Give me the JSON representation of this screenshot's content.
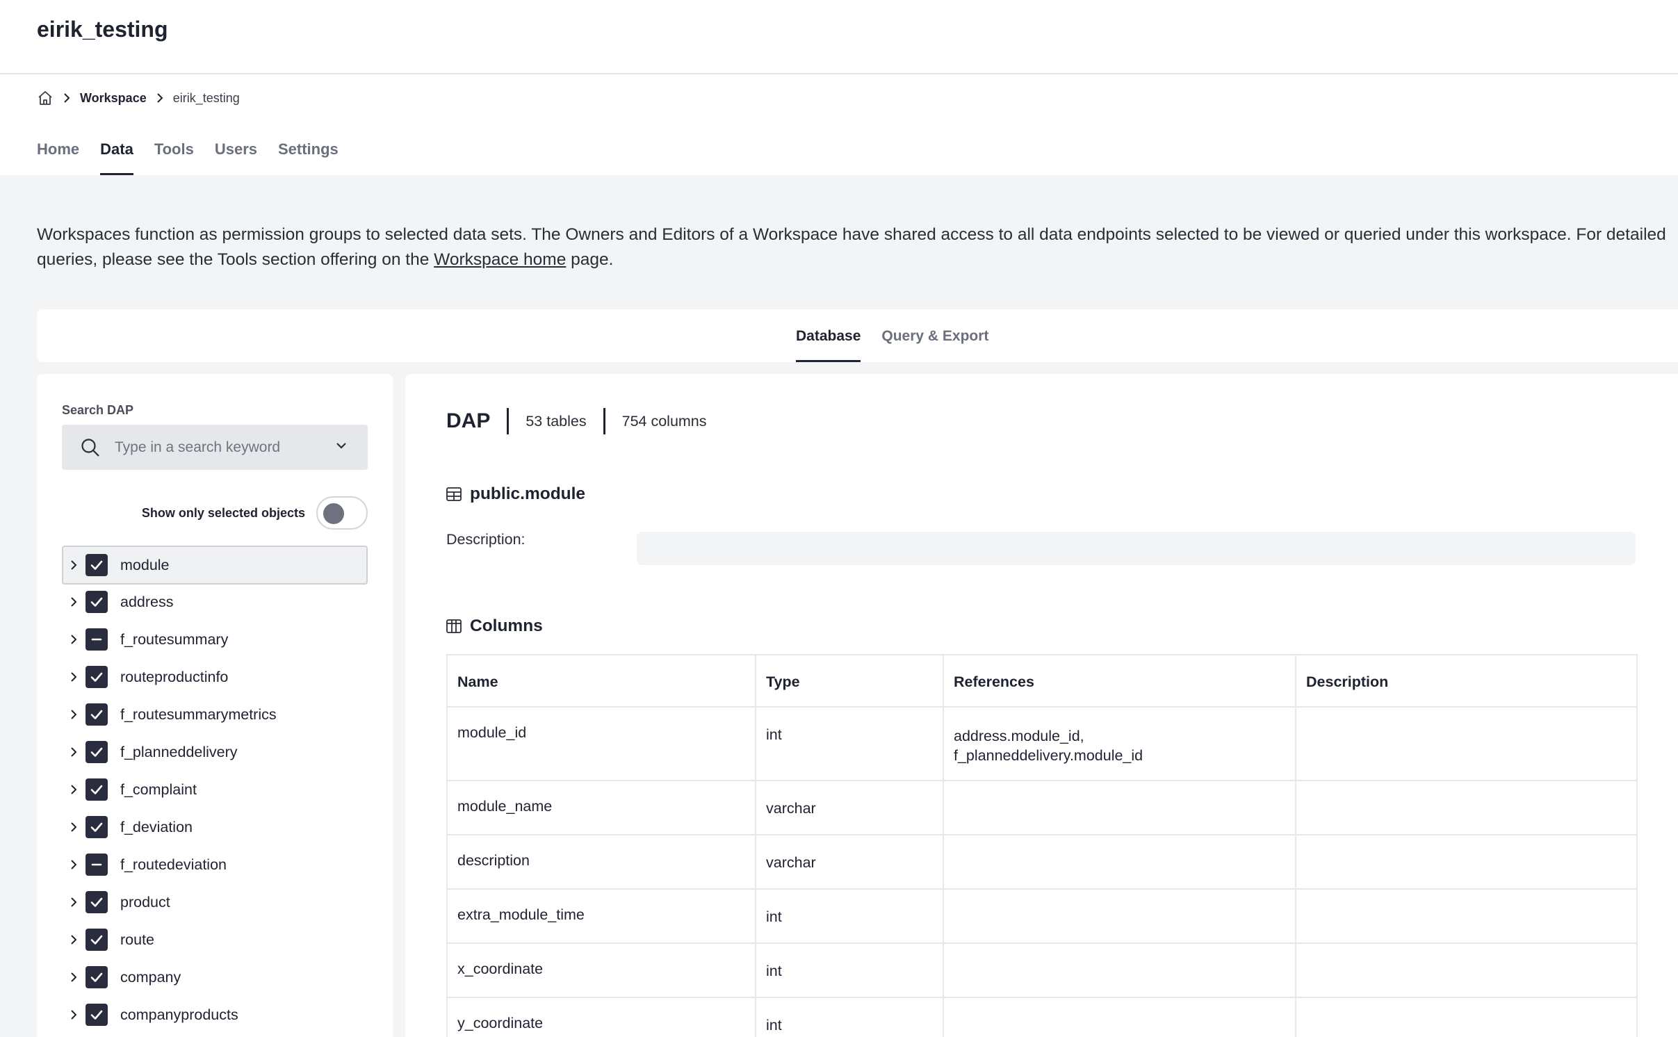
{
  "app": {
    "title": "eirik_testing"
  },
  "breadcrumb": {
    "items": [
      "Workspace",
      "eirik_testing"
    ]
  },
  "main_tabs": [
    {
      "label": "Home",
      "active": false
    },
    {
      "label": "Data",
      "active": true
    },
    {
      "label": "Tools",
      "active": false
    },
    {
      "label": "Users",
      "active": false
    },
    {
      "label": "Settings",
      "active": false
    }
  ],
  "intro": {
    "text_before": "Workspaces function as permission groups to selected data sets. The Owners and Editors of a Workspace have shared access to all data endpoints selected to be viewed or queried under this workspace. For detailed queries, please see the Tools section offering on the ",
    "link": "Workspace home",
    "text_after": " page."
  },
  "sub_tabs": [
    {
      "label": "Database",
      "active": true
    },
    {
      "label": "Query & Export",
      "active": false
    }
  ],
  "search": {
    "label": "Search DAP",
    "placeholder": "Type in a search keyword",
    "value": ""
  },
  "toggle": {
    "label": "Show only selected objects",
    "on": false
  },
  "tree": [
    {
      "label": "module",
      "state": "checked"
    },
    {
      "label": "address",
      "state": "checked"
    },
    {
      "label": "f_routesummary",
      "state": "partial"
    },
    {
      "label": "routeproductinfo",
      "state": "checked"
    },
    {
      "label": "f_routesummarymetrics",
      "state": "checked"
    },
    {
      "label": "f_planneddelivery",
      "state": "checked"
    },
    {
      "label": "f_complaint",
      "state": "checked"
    },
    {
      "label": "f_deviation",
      "state": "checked"
    },
    {
      "label": "f_routedeviation",
      "state": "partial"
    },
    {
      "label": "product",
      "state": "checked"
    },
    {
      "label": "route",
      "state": "checked"
    },
    {
      "label": "company",
      "state": "checked"
    },
    {
      "label": "companyproducts",
      "state": "checked"
    }
  ],
  "database": {
    "name": "DAP",
    "tables": "53 tables",
    "columns": "754 columns"
  },
  "table_detail": {
    "name": "public.module",
    "description_label": "Description:",
    "description": "",
    "columns_title": "Columns",
    "headers": [
      "Name",
      "Type",
      "References",
      "Description"
    ],
    "rows": [
      {
        "name": "module_id",
        "type": "int",
        "references": [
          "address.module_id,",
          "f_planneddelivery.module_id"
        ],
        "description": ""
      },
      {
        "name": "module_name",
        "type": "varchar",
        "references": [],
        "description": ""
      },
      {
        "name": "description",
        "type": "varchar",
        "references": [],
        "description": ""
      },
      {
        "name": "extra_module_time",
        "type": "int",
        "references": [],
        "description": ""
      },
      {
        "name": "x_coordinate",
        "type": "int",
        "references": [],
        "description": ""
      },
      {
        "name": "y_coordinate",
        "type": "int",
        "references": [],
        "description": ""
      }
    ]
  },
  "colors": {
    "accent": "#1f2230",
    "checkbox": "#2a2d3e",
    "page_bg": "#f3f4f6"
  }
}
